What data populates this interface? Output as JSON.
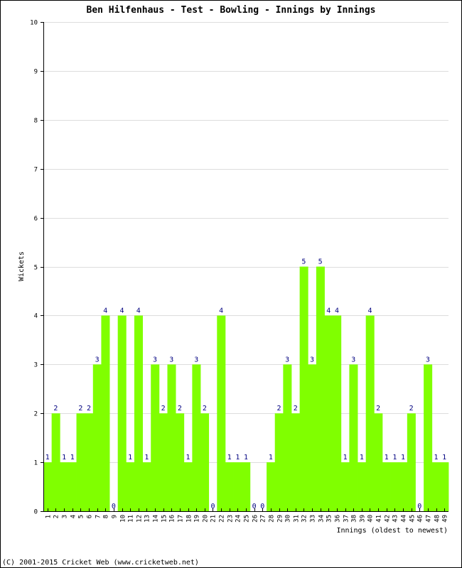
{
  "chart_data": {
    "type": "bar",
    "title": "Ben Hilfenhaus - Test - Bowling - Innings by Innings",
    "xlabel": "Innings (oldest to newest)",
    "ylabel": "Wickets",
    "ylim": [
      0,
      10
    ],
    "yticks": [
      0,
      1,
      2,
      3,
      4,
      5,
      6,
      7,
      8,
      9,
      10
    ],
    "grid": true,
    "bar_color": "#80ff00",
    "label_color": "#000080",
    "categories": [
      "1",
      "2",
      "3",
      "4",
      "5",
      "6",
      "7",
      "8",
      "9",
      "10",
      "11",
      "12",
      "13",
      "14",
      "15",
      "16",
      "17",
      "18",
      "19",
      "20",
      "21",
      "22",
      "23",
      "24",
      "25",
      "26",
      "27",
      "28",
      "29",
      "30",
      "31",
      "32",
      "33",
      "34",
      "35",
      "36",
      "37",
      "38",
      "39",
      "40",
      "41",
      "42",
      "43",
      "44",
      "45",
      "46",
      "47",
      "48",
      "49"
    ],
    "values": [
      1,
      2,
      1,
      1,
      2,
      2,
      3,
      4,
      0,
      4,
      1,
      4,
      1,
      3,
      2,
      3,
      2,
      1,
      3,
      2,
      0,
      4,
      1,
      1,
      1,
      0,
      0,
      1,
      2,
      3,
      2,
      5,
      3,
      5,
      4,
      4,
      1,
      3,
      1,
      4,
      2,
      1,
      1,
      1,
      2,
      0,
      3,
      1,
      1
    ]
  },
  "footer": {
    "copyright": "(C) 2001-2015 Cricket Web (www.cricketweb.net)"
  }
}
